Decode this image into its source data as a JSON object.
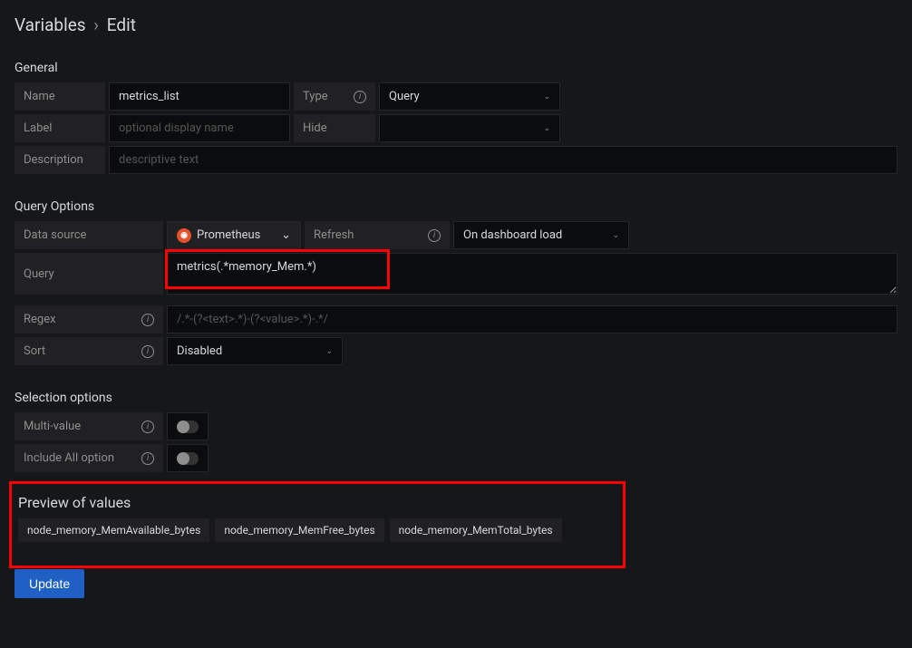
{
  "breadcrumb": {
    "root": "Variables",
    "current": "Edit"
  },
  "sections": {
    "general": "General",
    "queryOptions": "Query Options",
    "selectionOptions": "Selection options",
    "preview": "Preview of values"
  },
  "general": {
    "nameLabel": "Name",
    "nameValue": "metrics_list",
    "typeLabel": "Type",
    "typeValue": "Query",
    "labelLabel": "Label",
    "labelPlaceholder": "optional display name",
    "hideLabel": "Hide",
    "hideValue": "",
    "descriptionLabel": "Description",
    "descriptionPlaceholder": "descriptive text"
  },
  "queryOptions": {
    "dataSourceLabel": "Data source",
    "dataSourceValue": "Prometheus",
    "refreshLabel": "Refresh",
    "refreshValue": "On dashboard load",
    "queryLabel": "Query",
    "queryValue": "metrics(.*memory_Mem.*)",
    "regexLabel": "Regex",
    "regexPlaceholder": "/.*-(?<text>.*)-(?<value>.*)-.*/",
    "sortLabel": "Sort",
    "sortValue": "Disabled"
  },
  "selectionOptions": {
    "multiValueLabel": "Multi-value",
    "includeAllLabel": "Include All option"
  },
  "preview": {
    "values": [
      "node_memory_MemAvailable_bytes",
      "node_memory_MemFree_bytes",
      "node_memory_MemTotal_bytes"
    ]
  },
  "actions": {
    "update": "Update"
  }
}
